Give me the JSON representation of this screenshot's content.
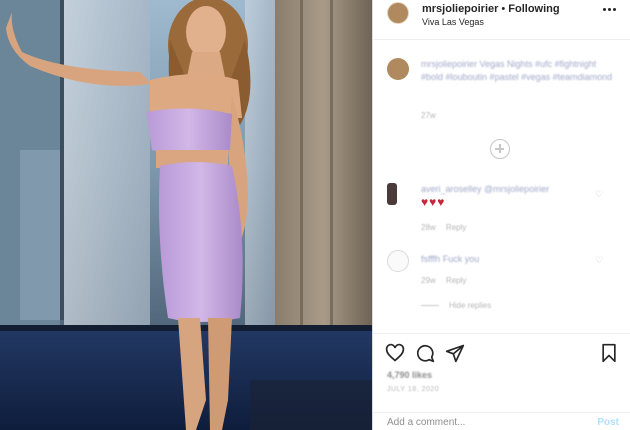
{
  "header": {
    "username": "mrsjoliepoirier",
    "separator": "•",
    "follow_label": "Following",
    "location": "Viva Las Vegas"
  },
  "caption": {
    "username": "mrsjoliepoirier",
    "text": "Vegas Nights",
    "hashtags": "#ufc #fightnight #bold #louboutin #pastel #vegas #teamdiamond",
    "time": "27w"
  },
  "comments": [
    {
      "username": "averi_aroselley",
      "mention": "@mrsjoliepoirier",
      "text": "♥♥♥",
      "time": "28w",
      "reply_label": "Reply"
    },
    {
      "username": "fsfffh",
      "text": "Fuck you",
      "time": "29w",
      "reply_label": "Reply",
      "view_replies_label": "Hide replies"
    }
  ],
  "actions": {
    "likes": "4,790 likes",
    "date": "JULY 18, 2020",
    "add_comment_placeholder": "Add a comment...",
    "post_label": "Post"
  },
  "icons": [
    "more-icon",
    "heart-icon",
    "comment-icon",
    "share-icon",
    "bookmark-icon",
    "plus-circle-icon"
  ],
  "colors": {
    "link": "#b2dffc",
    "heart_red": "#c8263a",
    "muted": "#8e8e8e"
  }
}
